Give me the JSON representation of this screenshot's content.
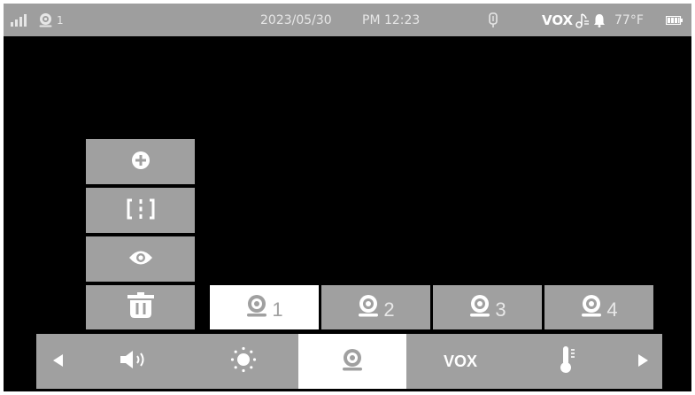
{
  "status_bar": {
    "camera_number": "1",
    "date": "2023/05/30",
    "time": "PM 12:23",
    "vox": "VOX",
    "temperature": "77°F"
  },
  "side_menu": {
    "items": [
      {
        "icon": "plus-circle-icon"
      },
      {
        "icon": "split-screen-icon"
      },
      {
        "icon": "eye-icon"
      },
      {
        "icon": "trash-icon"
      }
    ]
  },
  "camera_tabs": [
    {
      "number": "1",
      "active": true
    },
    {
      "number": "2",
      "active": false
    },
    {
      "number": "3",
      "active": false
    },
    {
      "number": "4",
      "active": false
    }
  ],
  "bottom_bar": {
    "vox_label": "VOX",
    "active_item": "camera"
  },
  "colors": {
    "bar_gray": "#a0a0a0",
    "status_gray": "#9e9e9e",
    "active_white": "#ffffff",
    "screen_black": "#000000"
  }
}
